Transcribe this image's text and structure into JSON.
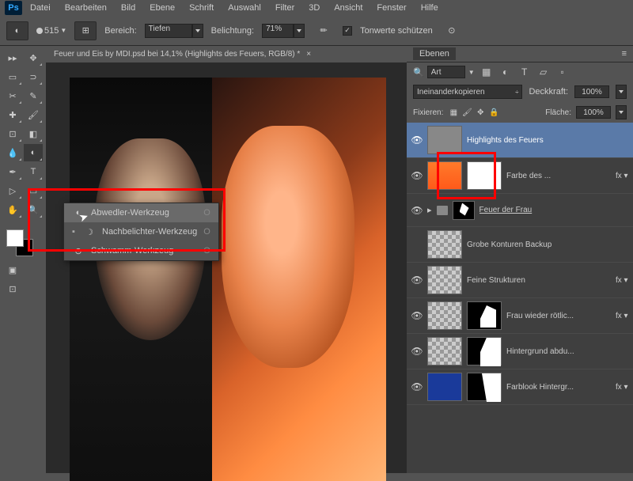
{
  "menu": [
    "Datei",
    "Bearbeiten",
    "Bild",
    "Ebene",
    "Schrift",
    "Auswahl",
    "Filter",
    "3D",
    "Ansicht",
    "Fenster",
    "Hilfe"
  ],
  "toolbar": {
    "brush_size": "515",
    "range_label": "Bereich:",
    "range_value": "Tiefen",
    "exposure_label": "Belichtung:",
    "exposure_value": "71%",
    "protect_tones": "Tonwerte schützen"
  },
  "doc_tab": "Feuer und Eis by MDI.psd bei 14,1% (Highlights des Feuers, RGB/8) *",
  "flyout": {
    "items": [
      {
        "icon": "dodge",
        "label": "Abwedler-Werkzeug",
        "key": "O"
      },
      {
        "icon": "burn",
        "label": "Nachbelichter-Werkzeug",
        "key": "O"
      },
      {
        "icon": "sponge",
        "label": "Schwamm-Werkzeug",
        "key": "O"
      }
    ]
  },
  "panel": {
    "tab": "Ebenen",
    "search_placeholder": "Art",
    "blend_mode": "Ineinanderkopieren",
    "opacity_label": "Deckkraft:",
    "opacity_value": "100%",
    "lock_label": "Fixieren:",
    "fill_label": "Fläche:",
    "fill_value": "100%"
  },
  "layers": [
    {
      "name": "Highlights des Feuers",
      "selected": true,
      "thumb": "gray",
      "visible": true
    },
    {
      "name": "Farbe des ...",
      "thumb": "orange",
      "mask": "white",
      "fx": true,
      "visible": true
    },
    {
      "name": "Feuer der Frau",
      "group": true,
      "visible": true,
      "underline": true
    },
    {
      "name": "Grobe Konturen Backup",
      "thumb": "checker",
      "visible": false
    },
    {
      "name": "Feine Strukturen",
      "thumb": "checker",
      "fx": true,
      "visible": true
    },
    {
      "name": "Frau wieder rötlic...",
      "thumb": "checker",
      "mask": "shape1",
      "fx": true,
      "visible": true
    },
    {
      "name": "Hintergrund abdu...",
      "thumb": "checker",
      "mask": "shape2",
      "visible": true
    },
    {
      "name": "Farblook Hintergr...",
      "thumb": "blue",
      "mask": "shape3",
      "fx": true,
      "visible": true
    }
  ]
}
